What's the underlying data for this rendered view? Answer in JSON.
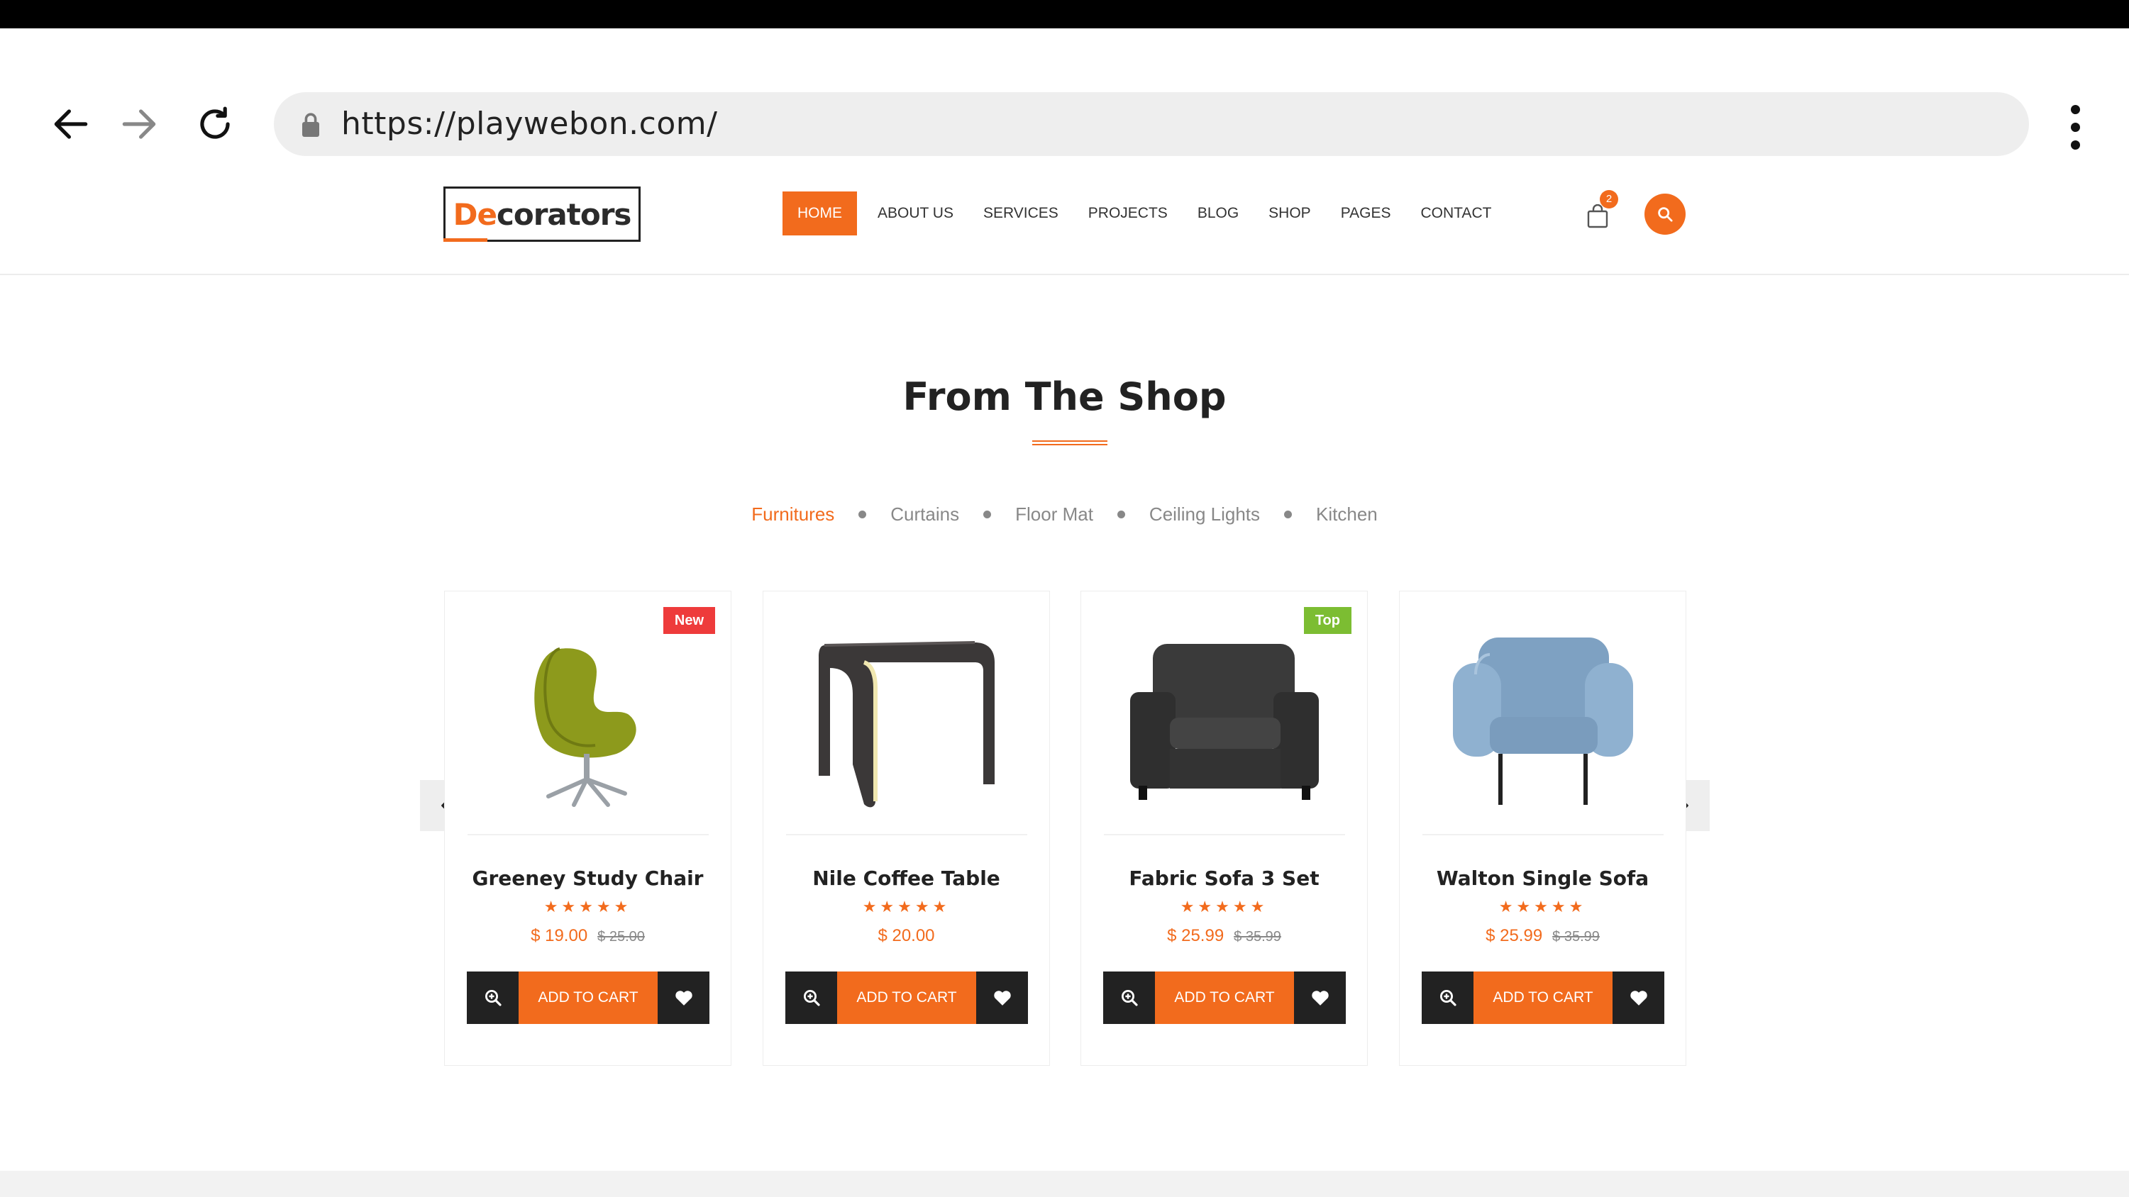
{
  "browser": {
    "url": "https://playwebon.com/"
  },
  "header": {
    "logo_accent": "De",
    "logo_rest": "corators",
    "nav": [
      {
        "label": "HOME",
        "active": true
      },
      {
        "label": "ABOUT US",
        "active": false
      },
      {
        "label": "SERVICES",
        "active": false
      },
      {
        "label": "PROJECTS",
        "active": false
      },
      {
        "label": "BLOG",
        "active": false
      },
      {
        "label": "SHOP",
        "active": false
      },
      {
        "label": "PAGES",
        "active": false
      },
      {
        "label": "CONTACT",
        "active": false
      }
    ],
    "cart_count": "2"
  },
  "section": {
    "title": "From The Shop",
    "filters": [
      "Furnitures",
      "Curtains",
      "Floor Mat",
      "Ceiling Lights",
      "Kitchen"
    ],
    "active_filter": "Furnitures"
  },
  "products": [
    {
      "name": "Greeney Study Chair",
      "price": "$ 19.00",
      "old_price": "$ 25.00",
      "badge": "New",
      "stars": "★★★★★",
      "cart_label": "ADD TO CART"
    },
    {
      "name": "Nile Coffee Table",
      "price": "$ 20.00",
      "old_price": "",
      "badge": "",
      "stars": "★★★★★",
      "cart_label": "ADD TO CART"
    },
    {
      "name": "Fabric Sofa 3 Set",
      "price": "$ 25.99",
      "old_price": "$ 35.99",
      "badge": "Top",
      "stars": "★★★★★",
      "cart_label": "ADD TO CART"
    },
    {
      "name": "Walton Single Sofa",
      "price": "$ 25.99",
      "old_price": "$ 35.99",
      "badge": "",
      "stars": "★★★★★",
      "cart_label": "ADD TO CART"
    }
  ],
  "colors": {
    "accent": "#f26b1d",
    "dark": "#222222",
    "badge_new": "#ee3b3b",
    "badge_top": "#7cbd32"
  }
}
